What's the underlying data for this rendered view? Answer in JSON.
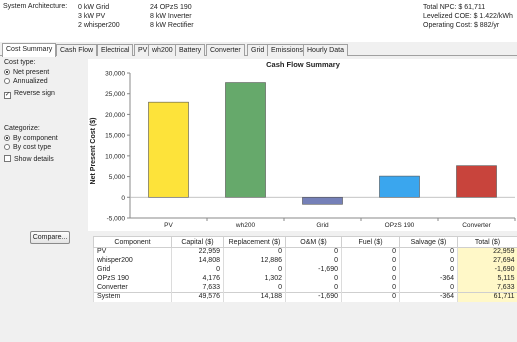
{
  "architecture": {
    "label": "System Architecture:",
    "col1": [
      "0 kW Grid",
      "3 kW PV",
      "2 whisper200"
    ],
    "col2": [
      "24 OPzS 190",
      "8 kW Inverter",
      "8 kW Rectifier"
    ],
    "summary": [
      "Total NPC:  $ 61,711",
      "Levelized COE:  $ 1.422/kWh",
      "Operating Cost:  $ 882/yr"
    ]
  },
  "tabs": [
    "Cost Summary",
    "Cash Flow",
    "Electrical",
    "PV",
    "wh200",
    "Battery",
    "Converter",
    "Grid",
    "Emissions",
    "Hourly Data"
  ],
  "active_tab": "Cost Summary",
  "side": {
    "cost_type_label": "Cost type:",
    "net_present": "Net present",
    "annualized": "Annualized",
    "reverse_sign": "Reverse sign",
    "categorize_label": "Categorize:",
    "by_component": "By component",
    "by_cost_type": "By cost type",
    "show_details": "Show details",
    "compare_button": "Compare..."
  },
  "chart_data": {
    "type": "bar",
    "title": "Cash Flow Summary",
    "ylabel": "Net Present Cost ($)",
    "xlabel": "",
    "categories": [
      "PV",
      "wh200",
      "Grid",
      "OPzS 190",
      "Converter"
    ],
    "values": [
      22959,
      27694,
      -1690,
      5115,
      7633
    ],
    "colors": [
      "#fde33a",
      "#66a96b",
      "#7580b8",
      "#3aa6ee",
      "#c8443c"
    ],
    "ylim": [
      -5000,
      30000
    ],
    "yticks": [
      -5000,
      0,
      5000,
      10000,
      15000,
      20000,
      25000,
      30000
    ],
    "ytick_labels": [
      "-5,000",
      "0",
      "5,000",
      "10,000",
      "15,000",
      "20,000",
      "25,000",
      "30,000"
    ],
    "grid": false,
    "legend": "none"
  },
  "table": {
    "columns": [
      "Component",
      "Capital ($)",
      "Replacement ($)",
      "O&M ($)",
      "Fuel ($)",
      "Salvage ($)",
      "Total ($)"
    ],
    "rows": [
      [
        "PV",
        "22,959",
        "0",
        "0",
        "0",
        "0",
        "22,959"
      ],
      [
        "whisper200",
        "14,808",
        "12,886",
        "0",
        "0",
        "0",
        "27,694"
      ],
      [
        "Grid",
        "0",
        "0",
        "-1,690",
        "0",
        "0",
        "-1,690"
      ],
      [
        "OPzS 190",
        "4,176",
        "1,302",
        "0",
        "0",
        "-364",
        "5,115"
      ],
      [
        "Converter",
        "7,633",
        "0",
        "0",
        "0",
        "0",
        "7,633"
      ],
      [
        "System",
        "49,576",
        "14,188",
        "-1,690",
        "0",
        "-364",
        "61,711"
      ]
    ]
  }
}
